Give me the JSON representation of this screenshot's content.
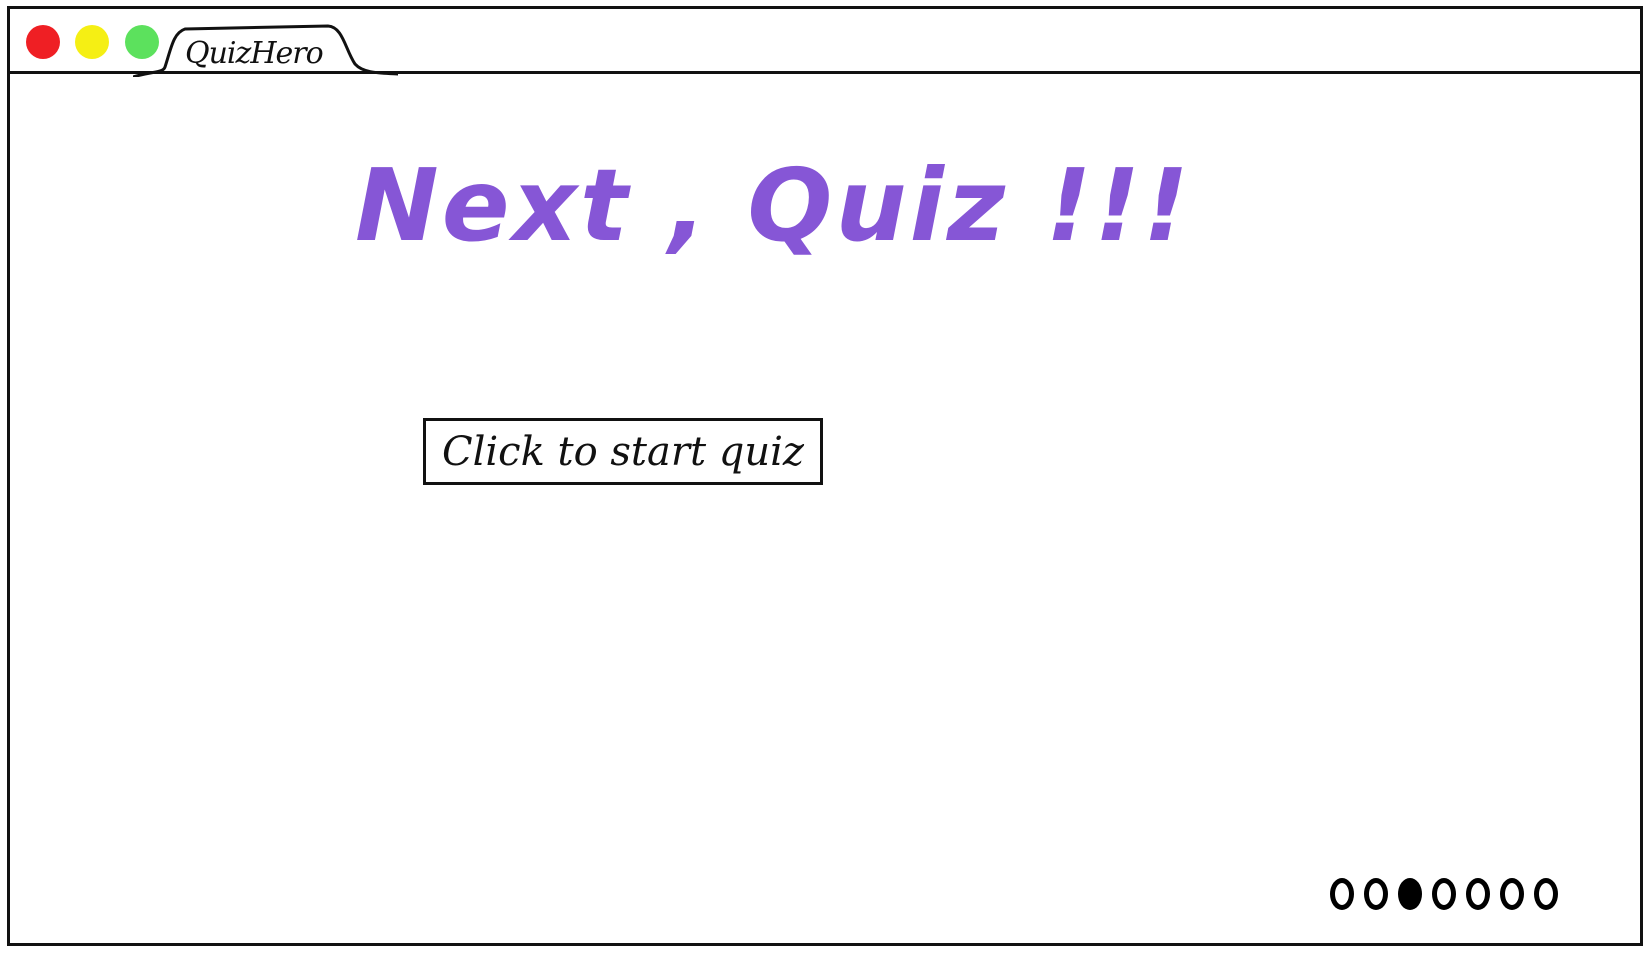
{
  "window": {
    "tab_title": "QuizHero",
    "controls": [
      {
        "name": "close",
        "color": "#ef1f24"
      },
      {
        "name": "minimize",
        "color": "#f5ef14"
      },
      {
        "name": "maximize",
        "color": "#5ce15d"
      }
    ]
  },
  "main": {
    "headline": "Next , Quiz !!!",
    "headline_color": "#8656d6",
    "start_button_label": "Click to start quiz"
  },
  "pager": {
    "total": 7,
    "current": 3
  }
}
